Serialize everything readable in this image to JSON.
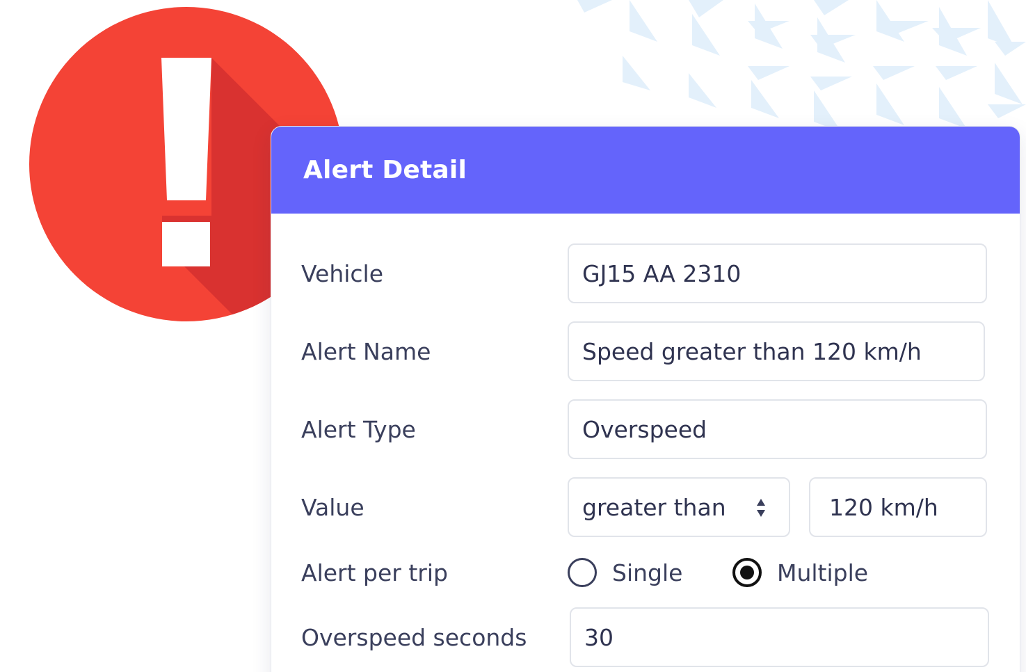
{
  "dialog": {
    "title": "Alert Detail"
  },
  "fields": {
    "vehicle": {
      "label": "Vehicle",
      "value": "GJ15 AA 2310"
    },
    "alert_name": {
      "label": "Alert Name",
      "value": "Speed greater than 120 km/h"
    },
    "alert_type": {
      "label": "Alert Type",
      "value": "Overspeed"
    },
    "value": {
      "label": "Value",
      "operator": "greater than",
      "amount": "120 km/h"
    },
    "alert_per_trip": {
      "label": "Alert per trip",
      "options": [
        "Single",
        "Multiple"
      ],
      "selected": "Multiple"
    },
    "overspeed_seconds": {
      "label": "Overspeed seconds",
      "value": "30"
    }
  },
  "colors": {
    "header": "#6464fb",
    "badge_red": "#f44336",
    "text": "#3a3f5c"
  },
  "icons": {
    "badge": "exclamation-alert-icon",
    "select": "up-down-arrows-icon",
    "pattern": "triangle-pattern"
  }
}
